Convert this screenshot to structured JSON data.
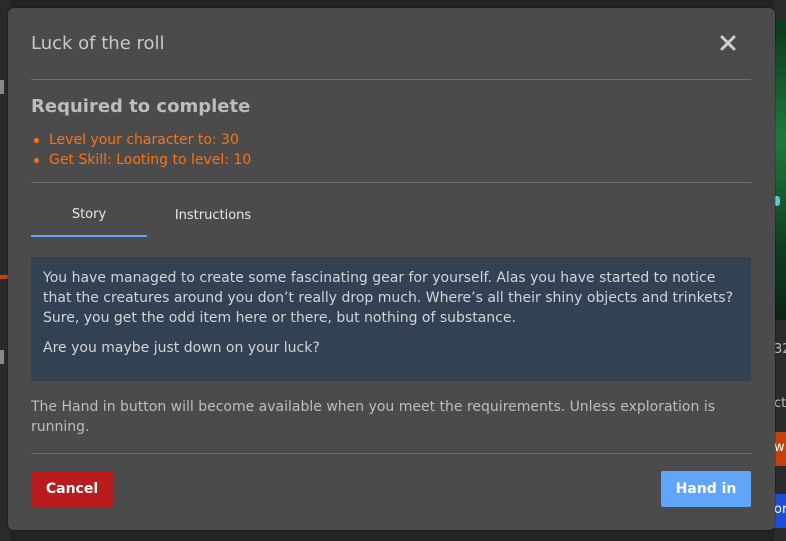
{
  "background": {
    "right_text_1": "32",
    "right_text_2": "ct",
    "right_button_1": "w",
    "right_button_2": "or"
  },
  "modal": {
    "title": "Luck of the roll",
    "close_icon": "close-icon",
    "requirements": {
      "title": "Required to complete",
      "items": [
        "Level your character to: 30",
        "Get Skill: Looting to level: 10"
      ]
    },
    "tabs": [
      {
        "label": "Story",
        "active": true
      },
      {
        "label": "Instructions",
        "active": false
      }
    ],
    "story": {
      "paragraphs": [
        "You have managed to create some fascinating gear for yourself. Alas you have started to notice that the creatures around you don’t really drop much. Where’s all their shiny objects and trinkets? Sure, you get the odd item here or there, but nothing of substance.",
        "Are you maybe just down on your luck?"
      ]
    },
    "note": "The Hand in button will become available when you meet the requirements. Unless exploration is running.",
    "buttons": {
      "cancel": "Cancel",
      "hand_in": "Hand in"
    }
  },
  "colors": {
    "modal_bg": "#4b4b4b",
    "requirement_text": "#f97316",
    "story_bg": "#334155",
    "tab_active_underline": "#60a5fa",
    "cancel_bg": "#b91c1c",
    "hand_in_bg": "#60a5fa"
  }
}
